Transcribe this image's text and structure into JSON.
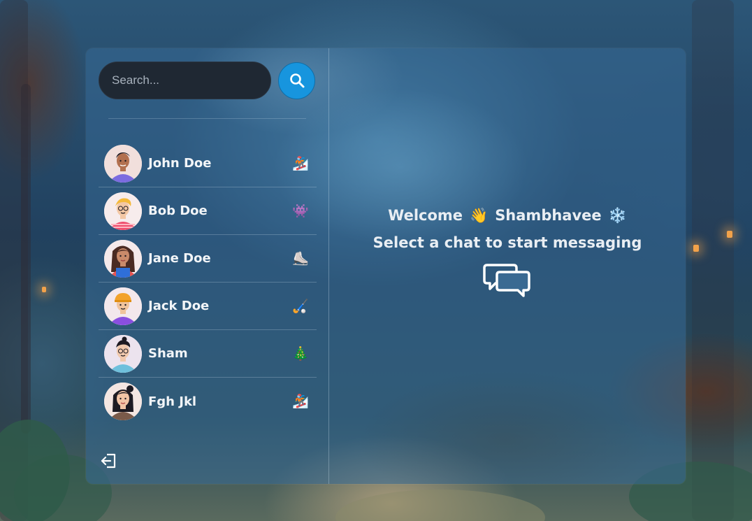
{
  "search": {
    "placeholder": "Search..."
  },
  "contacts": [
    {
      "name": "John Doe",
      "emoji": "🏂",
      "avatar": "avatar-john"
    },
    {
      "name": "Bob Doe",
      "emoji": "👾",
      "avatar": "avatar-bob"
    },
    {
      "name": "Jane Doe",
      "emoji": "⛸️",
      "avatar": "avatar-jane"
    },
    {
      "name": "Jack Doe",
      "emoji": "🏑",
      "avatar": "avatar-jack"
    },
    {
      "name": "Sham",
      "emoji": "🎄",
      "avatar": "avatar-sham"
    },
    {
      "name": "Fgh Jkl",
      "emoji": "🏂",
      "avatar": "avatar-fgh"
    }
  ],
  "welcome": {
    "greeting": "Welcome",
    "wave_emoji": "👋",
    "username": "Shambhavee",
    "user_emoji": "❄️",
    "prompt": "Select a chat to start messaging"
  },
  "icons": {
    "search": "search-icon",
    "logout": "logout-icon",
    "chat": "chat-bubbles-icon"
  },
  "colors": {
    "accent": "#1795de",
    "search_bg": "#1f2833",
    "text": "#e9eef3"
  }
}
